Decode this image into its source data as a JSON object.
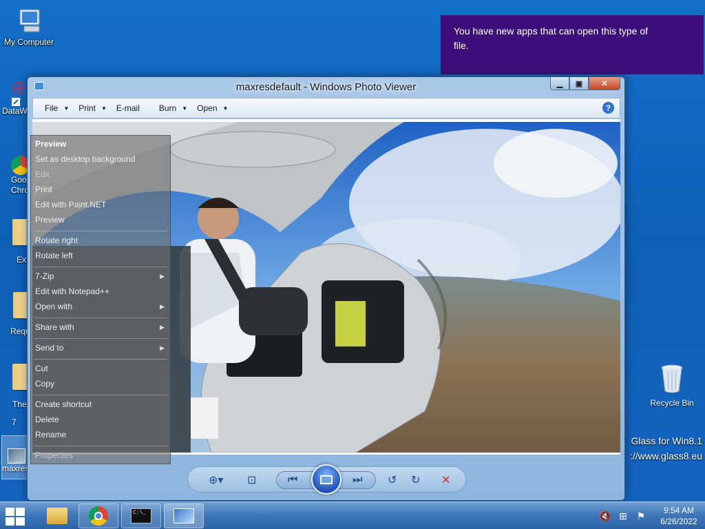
{
  "desktop": {
    "icons": [
      {
        "label": "My Computer"
      },
      {
        "label": "DataW"
      },
      {
        "label": "Goo"
      },
      {
        "label": "Chro"
      },
      {
        "label": "Ext"
      },
      {
        "label": "Requ"
      },
      {
        "label": "The"
      },
      {
        "label": "maxres"
      },
      {
        "label": "7"
      }
    ],
    "recycle_bin": "Recycle Bin",
    "glass_line1": "Glass for Win8.1",
    "glass_line2": "://www.glass8.eu"
  },
  "notification": {
    "text": "You have new apps that can open this type of file."
  },
  "window": {
    "title": "maxresdefault - Windows Photo Viewer",
    "menu": [
      {
        "label": "File",
        "has_arrow": true
      },
      {
        "label": "Print",
        "has_arrow": true
      },
      {
        "label": "E-mail",
        "has_arrow": false
      },
      {
        "label": "Burn",
        "has_arrow": true
      },
      {
        "label": "Open",
        "has_arrow": true
      }
    ],
    "help": "?"
  },
  "context_menu": {
    "items": [
      {
        "label": "Preview",
        "style": "bold"
      },
      {
        "label": "Set as desktop background",
        "style": "normal"
      },
      {
        "label": "Edit",
        "style": "dim"
      },
      {
        "label": "Print",
        "style": "normal"
      },
      {
        "label": "Edit with Paint.NET",
        "style": "normal"
      },
      {
        "label": "Preview",
        "style": "normal"
      },
      {
        "label": "Rotate right",
        "style": "normal"
      },
      {
        "label": "Rotate left",
        "style": "normal"
      },
      {
        "label": "7-Zip",
        "style": "normal"
      },
      {
        "label": "Edit with Notepad++",
        "style": "normal"
      },
      {
        "label": "Open with",
        "style": "normal"
      },
      {
        "label": "Share with",
        "style": "normal"
      },
      {
        "label": "Send to",
        "style": "normal"
      },
      {
        "label": "Cut",
        "style": "normal"
      },
      {
        "label": "Copy",
        "style": "normal"
      },
      {
        "label": "Create shortcut",
        "style": "normal"
      },
      {
        "label": "Delete",
        "style": "normal"
      },
      {
        "label": "Rename",
        "style": "normal"
      },
      {
        "label": "Properties",
        "style": "dim"
      }
    ]
  },
  "taskbar": {
    "time": "9:54 AM",
    "date": "6/26/2022",
    "cmd_label": "C:\\_"
  },
  "colors": {
    "notification_bg": "#3d0f7a",
    "desktop_bg": "#1570c8",
    "close_red": "#c7452a"
  }
}
